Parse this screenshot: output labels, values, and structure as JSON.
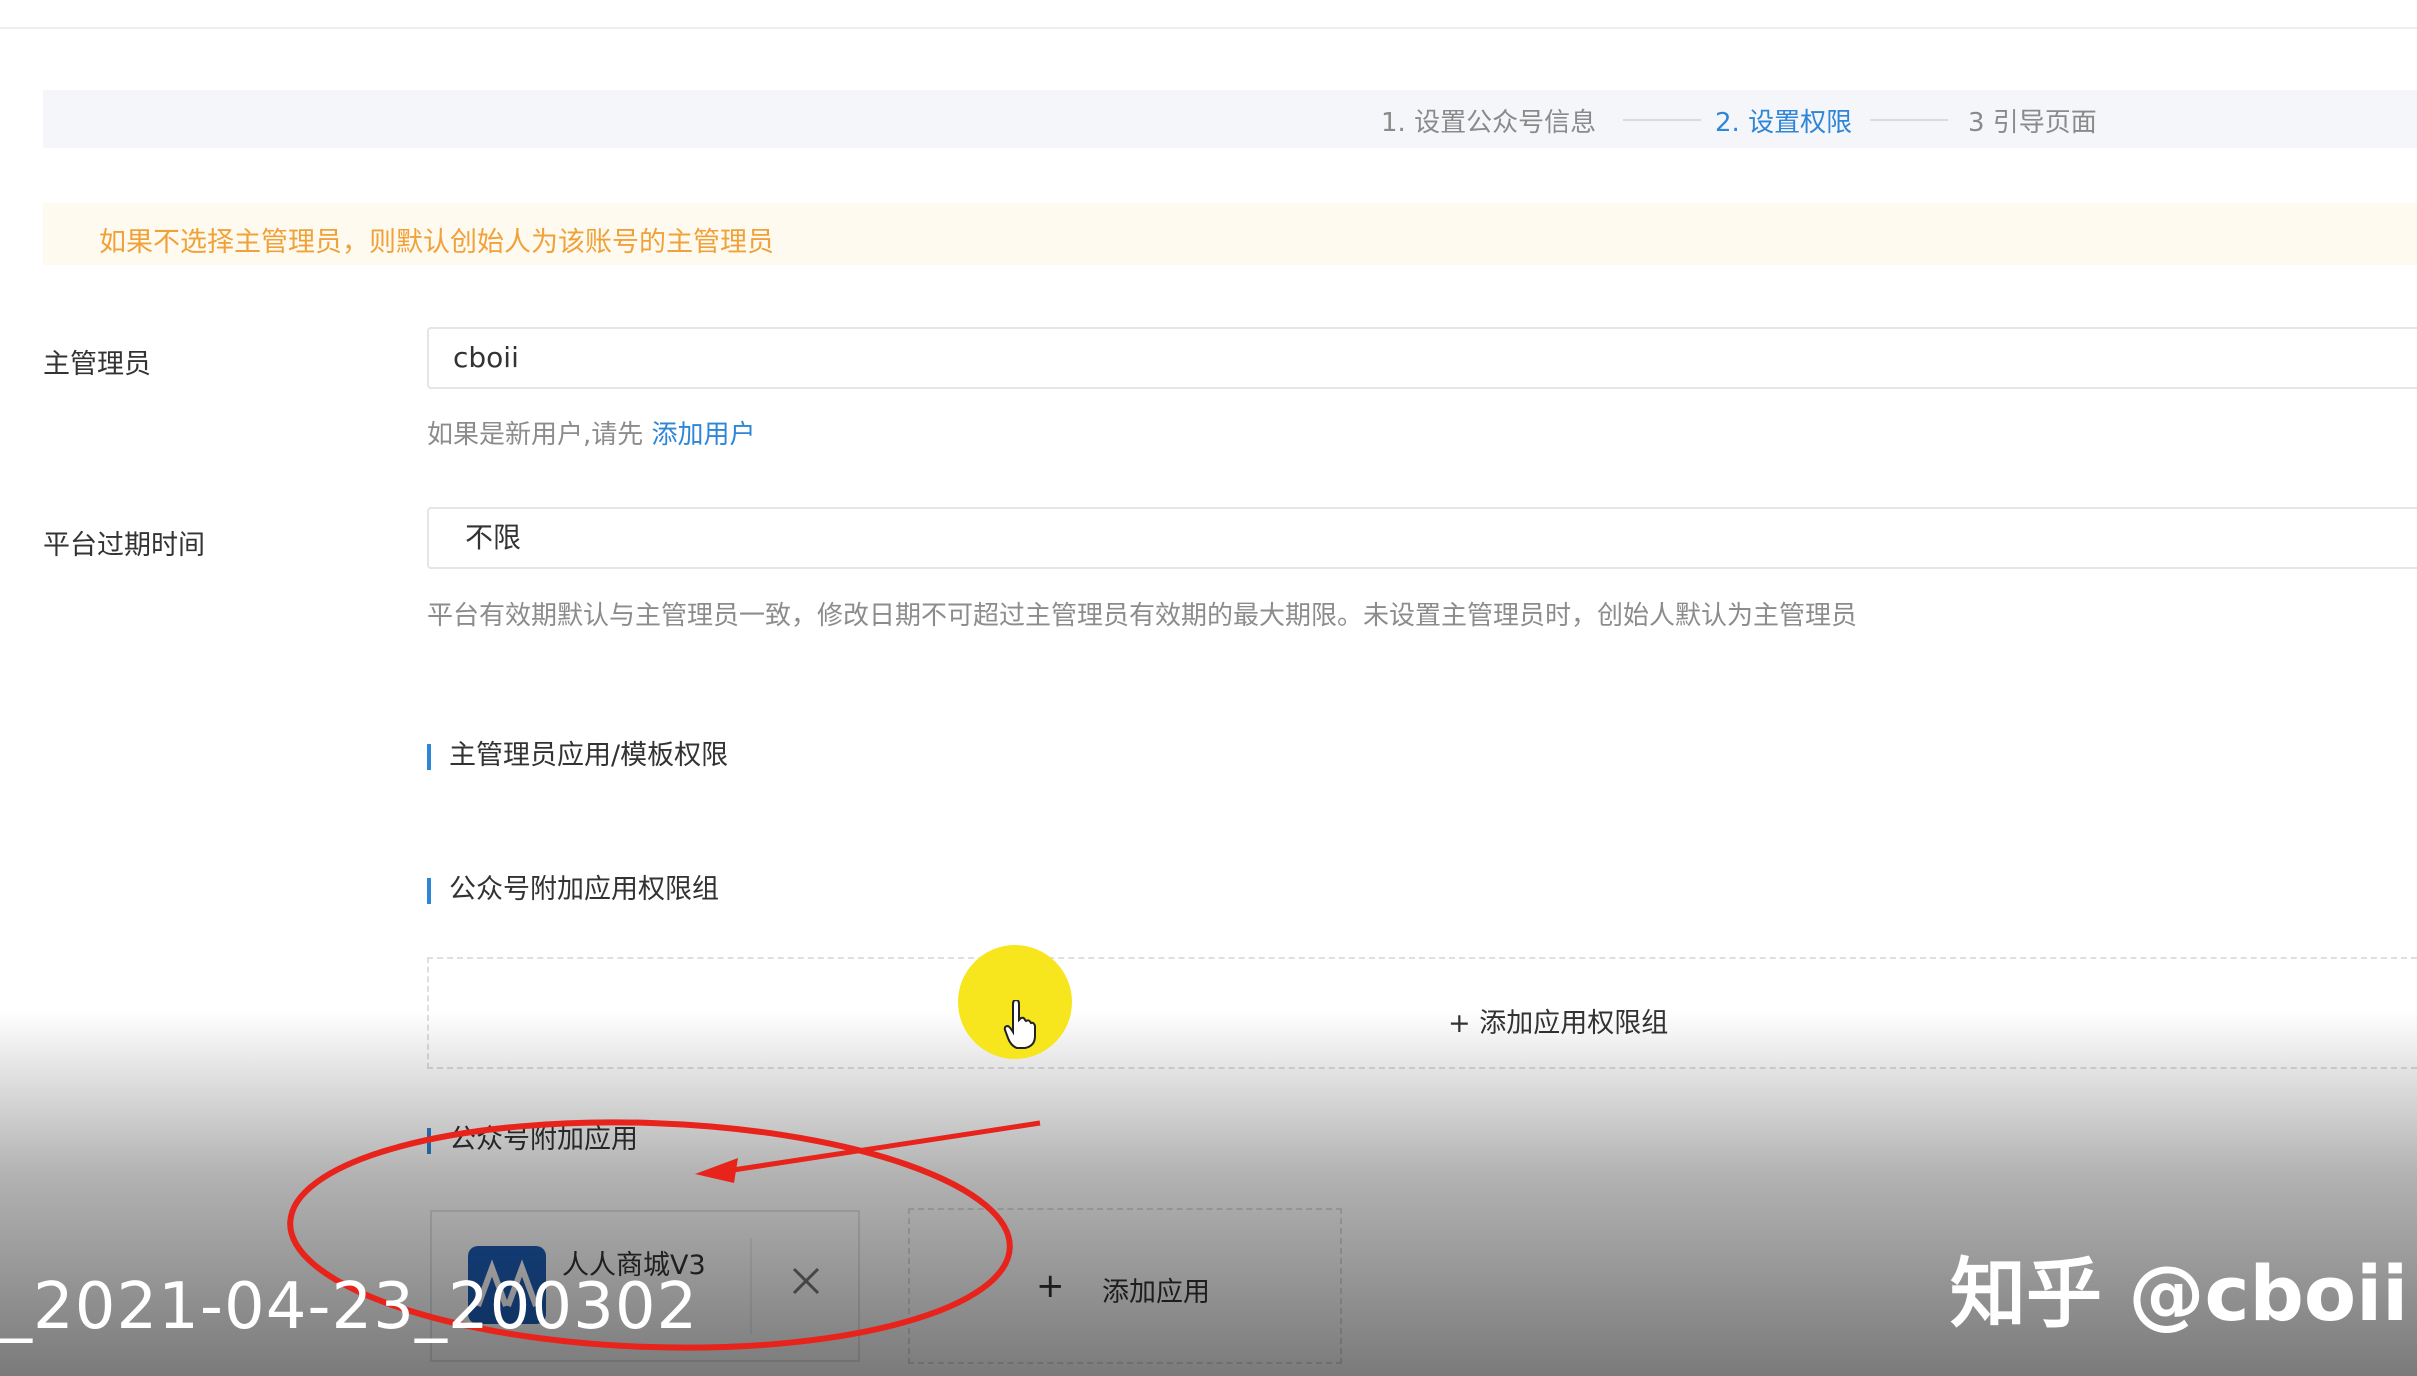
{
  "steps": {
    "step1": "1. 设置公众号信息",
    "step2": "2. 设置权限",
    "step3": "3 引导页面"
  },
  "notice": "如果不选择主管理员，则默认创始人为该账号的主管理员",
  "admin": {
    "label": "主管理员",
    "value": "cboii",
    "hint_prefix": "如果是新用户,请先",
    "hint_link": "添加用户"
  },
  "expire": {
    "label": "平台过期时间",
    "value": "不限",
    "hint": "平台有效期默认与主管理员一致，修改日期不可超过主管理员有效期的最大期限。未设置主管理员时，创始人默认为主管理员"
  },
  "sections": {
    "admin_perm": "主管理员应用/模板权限",
    "extra_group": "公众号附加应用权限组",
    "extra_app": "公众号附加应用"
  },
  "add_group": {
    "plus": "+",
    "label": "添加应用权限组"
  },
  "app": {
    "name": "人人商城V3"
  },
  "add_app": {
    "plus": "+",
    "label": "添加应用"
  },
  "overlay": {
    "filename": "_2021-04-23_200302",
    "watermark": "知乎 @cboii"
  },
  "colors": {
    "accent": "#2f86d6",
    "warning": "#f0a23a",
    "annotation": "#e8231b",
    "cursor": "#f7e51e"
  }
}
